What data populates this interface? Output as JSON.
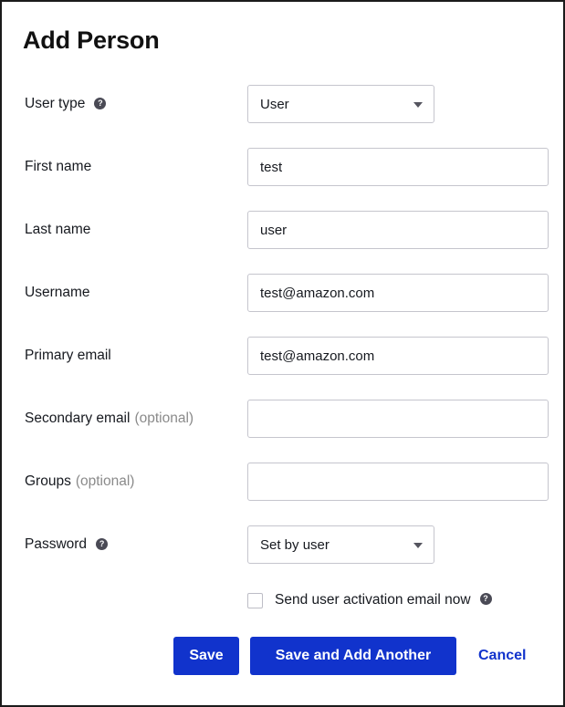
{
  "window": {
    "title": "Add Person",
    "border_color": "#1b1b1b",
    "background": "#ffffff"
  },
  "colors": {
    "accent_blue": "#1133cc",
    "label_text": "#16191f",
    "optional_text": "#8a8a8a",
    "field_border": "#c5c5cd",
    "info_icon_bg": "#4a4a55"
  },
  "form": {
    "rows": [
      {
        "label": "User type",
        "optional": "",
        "has_info_icon": true,
        "info_icon_name": "info-icon",
        "control": "select",
        "value": "User",
        "placeholder": ""
      },
      {
        "label": "First name",
        "optional": "",
        "has_info_icon": false,
        "info_icon_name": "",
        "control": "text",
        "value": "test",
        "placeholder": ""
      },
      {
        "label": "Last name",
        "optional": "",
        "has_info_icon": false,
        "info_icon_name": "",
        "control": "text",
        "value": "user",
        "placeholder": ""
      },
      {
        "label": "Username",
        "optional": "",
        "has_info_icon": false,
        "info_icon_name": "",
        "control": "text",
        "value": "test@amazon.com",
        "placeholder": ""
      },
      {
        "label": "Primary email",
        "optional": "",
        "has_info_icon": false,
        "info_icon_name": "",
        "control": "text",
        "value": "test@amazon.com",
        "placeholder": ""
      },
      {
        "label": "Secondary email",
        "optional": "(optional)",
        "has_info_icon": false,
        "info_icon_name": "",
        "control": "text",
        "value": "",
        "placeholder": ""
      },
      {
        "label": "Groups",
        "optional": "(optional)",
        "has_info_icon": false,
        "info_icon_name": "",
        "control": "text",
        "value": "",
        "placeholder": ""
      },
      {
        "label": "Password",
        "optional": "",
        "has_info_icon": true,
        "info_icon_name": "info-icon",
        "control": "select",
        "value": "Set by user",
        "placeholder": ""
      }
    ],
    "info_icon_glyph": "?",
    "checkbox": {
      "label": "Send user activation email now",
      "checked": false,
      "has_info_icon": true,
      "info_icon_glyph": "?"
    }
  },
  "actions": {
    "save_label": "Save",
    "save_and_add_another_label": "Save and Add Another",
    "cancel_label": "Cancel"
  }
}
